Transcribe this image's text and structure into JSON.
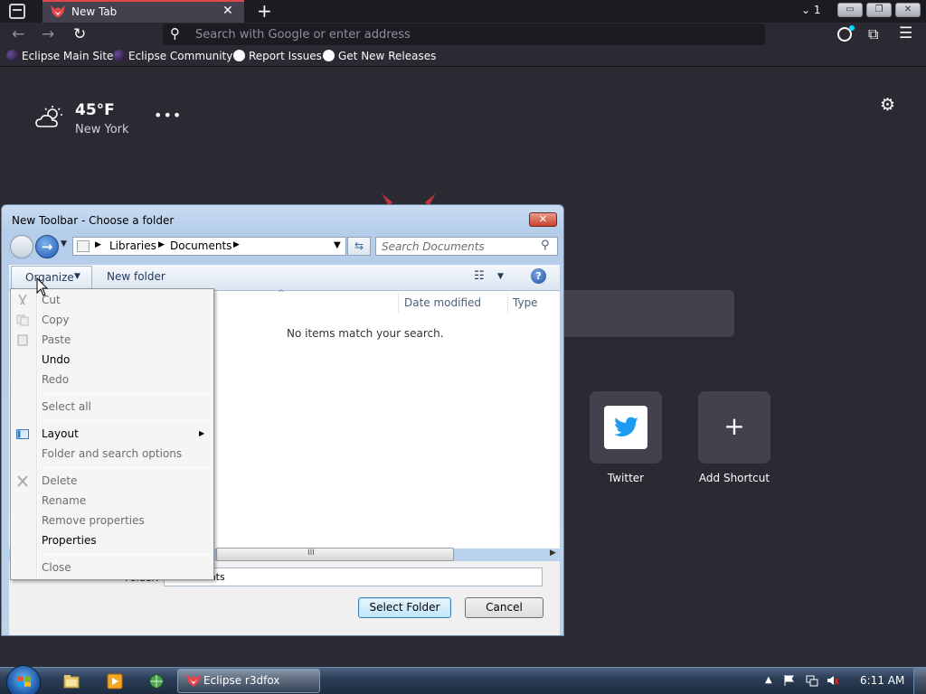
{
  "browser": {
    "tab": {
      "title": "New Tab",
      "close_label": "✕"
    },
    "newtab_label": "+",
    "listall_label": "1",
    "window_buttons": {
      "minimize": "▭",
      "maximize": "❐",
      "close": "✕"
    },
    "url_placeholder": "Search with Google or enter address",
    "bookmarks": [
      {
        "label": "Eclipse Main Site",
        "icon": "eclipse-icon"
      },
      {
        "label": "Eclipse Community",
        "icon": "eclipse-icon"
      },
      {
        "label": "Report Issues",
        "icon": "github-icon"
      },
      {
        "label": "Get New Releases",
        "icon": "github-icon"
      }
    ]
  },
  "newtab": {
    "weather": {
      "temp": "45°F",
      "city": "New York",
      "more": "•••",
      "icon": "partly-cloudy-icon"
    },
    "shortcuts": [
      {
        "label": "Twitter",
        "icon": "twitter-icon"
      },
      {
        "label": "Add Shortcut",
        "icon": "plus-icon",
        "glyph": "+"
      }
    ]
  },
  "dialog": {
    "title": "New Toolbar - Choose a folder",
    "close_label": "✕",
    "breadcrumbs": [
      "Libraries",
      "Documents"
    ],
    "search_placeholder": "Search Documents",
    "organize_label": "Organize",
    "new_folder_label": "New folder",
    "columns": {
      "date_modified": "Date modified",
      "type": "Type"
    },
    "empty_message": "No items match your search.",
    "scroll_grip": "III",
    "folder_label": "Folder:",
    "folder_value": "Documents",
    "select_folder_label": "Select Folder",
    "cancel_label": "Cancel"
  },
  "organize_menu": [
    {
      "label": "Cut",
      "enabled": false,
      "icon": "scissors-icon"
    },
    {
      "label": "Copy",
      "enabled": false,
      "icon": "copy-icon"
    },
    {
      "label": "Paste",
      "enabled": false,
      "icon": "paste-icon"
    },
    {
      "label": "Undo",
      "enabled": true
    },
    {
      "label": "Redo",
      "enabled": false
    },
    {
      "label": "Select all",
      "enabled": false
    },
    {
      "label": "Layout",
      "enabled": true,
      "icon": "layout-icon",
      "submenu": true
    },
    {
      "label": "Folder and search options",
      "enabled": false
    },
    {
      "label": "Delete",
      "enabled": false,
      "icon": "delete-icon"
    },
    {
      "label": "Rename",
      "enabled": false
    },
    {
      "label": "Remove properties",
      "enabled": false
    },
    {
      "label": "Properties",
      "enabled": true
    },
    {
      "label": "Close",
      "enabled": false
    }
  ],
  "taskbar": {
    "active_window": "Eclipse r3dfox",
    "clock": "6:11 AM",
    "tray_expand": "▲"
  },
  "colors": {
    "accent_tab": "#e0464a",
    "page_bg": "#2b2a33",
    "twitter_blue": "#1d9bf0"
  }
}
